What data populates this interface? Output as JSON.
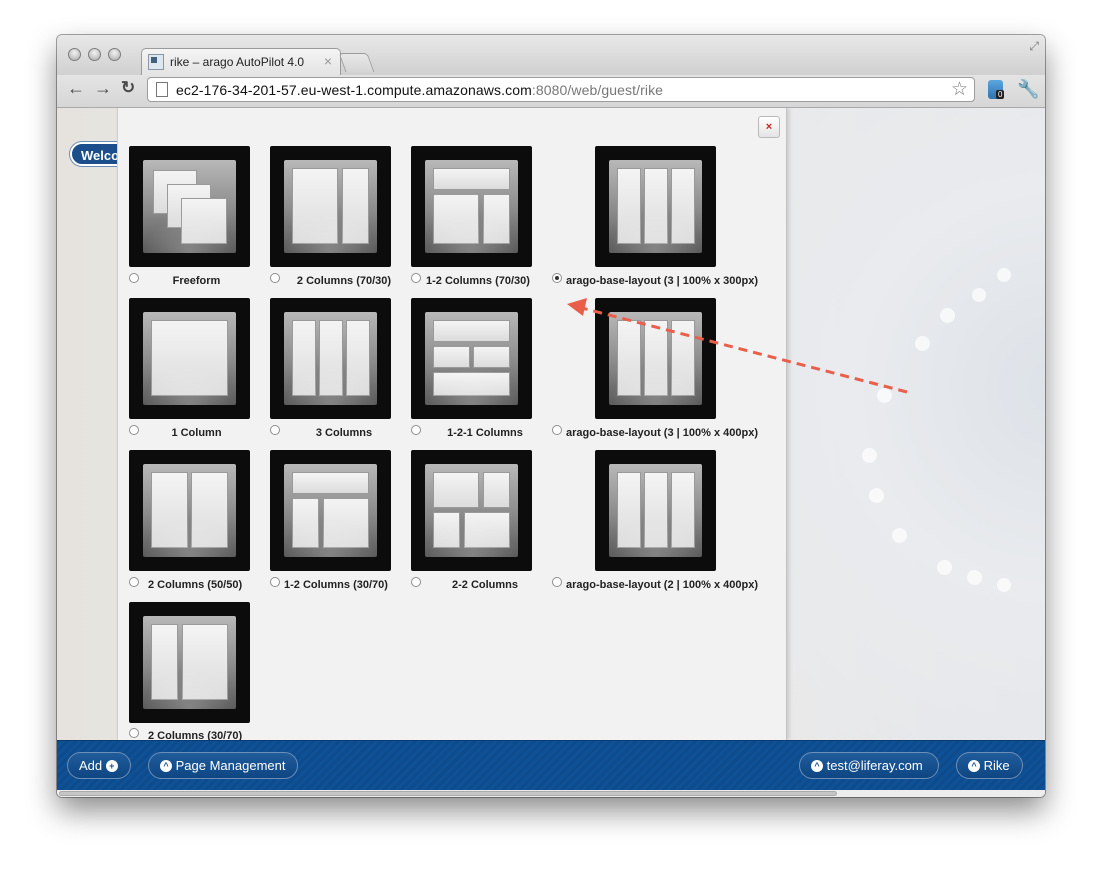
{
  "browser": {
    "tab_title": "rike – arago AutoPilot 4.0",
    "tab_close": "×",
    "url_host": "ec2-176-34-201-57.eu-west-1.compute.amazonaws.com",
    "url_rest": ":8080/web/guest/rike",
    "ext_badge": "0"
  },
  "page": {
    "welcome_label": "Welcome",
    "close_label": "×"
  },
  "layouts": [
    {
      "label": "Freeform",
      "selected": false
    },
    {
      "label": "2 Columns (70/30)",
      "selected": false
    },
    {
      "label": "1-2 Columns (70/30)",
      "selected": false
    },
    {
      "label": "arago-base-layout (3 | 100% x 300px)",
      "selected": true
    },
    {
      "label": "1 Column",
      "selected": false
    },
    {
      "label": "3 Columns",
      "selected": false
    },
    {
      "label": "1-2-1 Columns",
      "selected": false
    },
    {
      "label": "arago-base-layout (3 | 100% x 400px)",
      "selected": false
    },
    {
      "label": "2 Columns (50/50)",
      "selected": false
    },
    {
      "label": "1-2 Columns (30/70)",
      "selected": false
    },
    {
      "label": "2-2 Columns",
      "selected": false
    },
    {
      "label": "arago-base-layout (2 | 100% x 400px)",
      "selected": false
    },
    {
      "label": "2 Columns (30/70)",
      "selected": false
    }
  ],
  "dock": {
    "add_label": "Add",
    "page_management_label": "Page Management",
    "user_label": "test@liferay.com",
    "site_label": "Rike"
  },
  "colors": {
    "dock_blue": "#0d4b8c",
    "annotation_arrow": "#e8604a",
    "close_red": "#c3241f"
  }
}
